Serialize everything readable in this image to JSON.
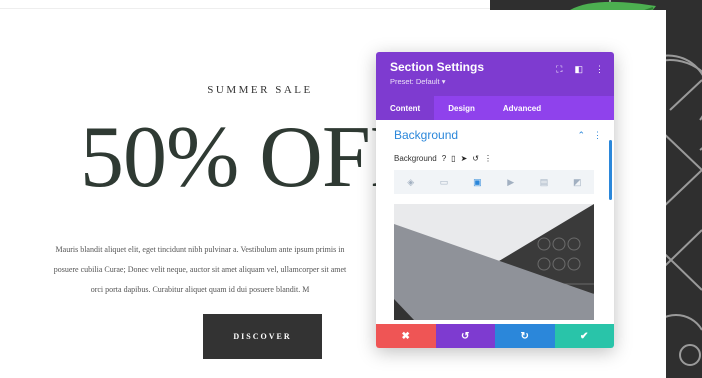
{
  "hero": {
    "eyebrow": "SUMMER SALE",
    "headline": "50% OFF",
    "body_lines": [
      "Mauris blandit aliquet elit, eget tincidunt nibh pulvinar a. Vestibulum ante ipsum primis in",
      "posuere cubilia Curae; Donec velit neque, auctor sit amet aliquam vel, ullamcorper sit amet",
      "orci porta dapibus. Curabitur aliquet quam id dui posuere blandit. M"
    ],
    "button_label": "DISCOVER"
  },
  "modal": {
    "title": "Section Settings",
    "preset": "Preset: Default ▾",
    "header_icons": [
      "expand-icon",
      "sidebar-icon",
      "more-vertical-icon"
    ],
    "tabs": [
      "Content",
      "Design",
      "Advanced"
    ],
    "active_tab": "Content",
    "section_title": "Background",
    "section_controls": [
      "chevron-up-icon",
      "more-vertical-icon"
    ],
    "bg_label": "Background",
    "bg_label_icons": [
      "help-icon",
      "phone-icon",
      "cursor-icon",
      "reset-icon",
      "more-vertical-icon"
    ],
    "bg_types": [
      "color-fill-icon",
      "gradient-icon",
      "image-icon",
      "video-icon",
      "pattern-icon",
      "mask-icon"
    ],
    "active_bg_type": "image-icon",
    "footer_buttons": [
      {
        "name": "cancel",
        "glyph": "✖",
        "color": "#ef5555"
      },
      {
        "name": "undo",
        "glyph": "↺",
        "color": "#7e3bd0"
      },
      {
        "name": "redo",
        "glyph": "↻",
        "color": "#2b87da"
      },
      {
        "name": "save",
        "glyph": "✔",
        "color": "#29c4a9"
      }
    ]
  },
  "colors": {
    "purple": "#7e3bd0",
    "purple_light": "#8f42ec",
    "blue": "#2b87da",
    "dark_panel": "#2f2f2f",
    "headline": "#2f3a33"
  }
}
